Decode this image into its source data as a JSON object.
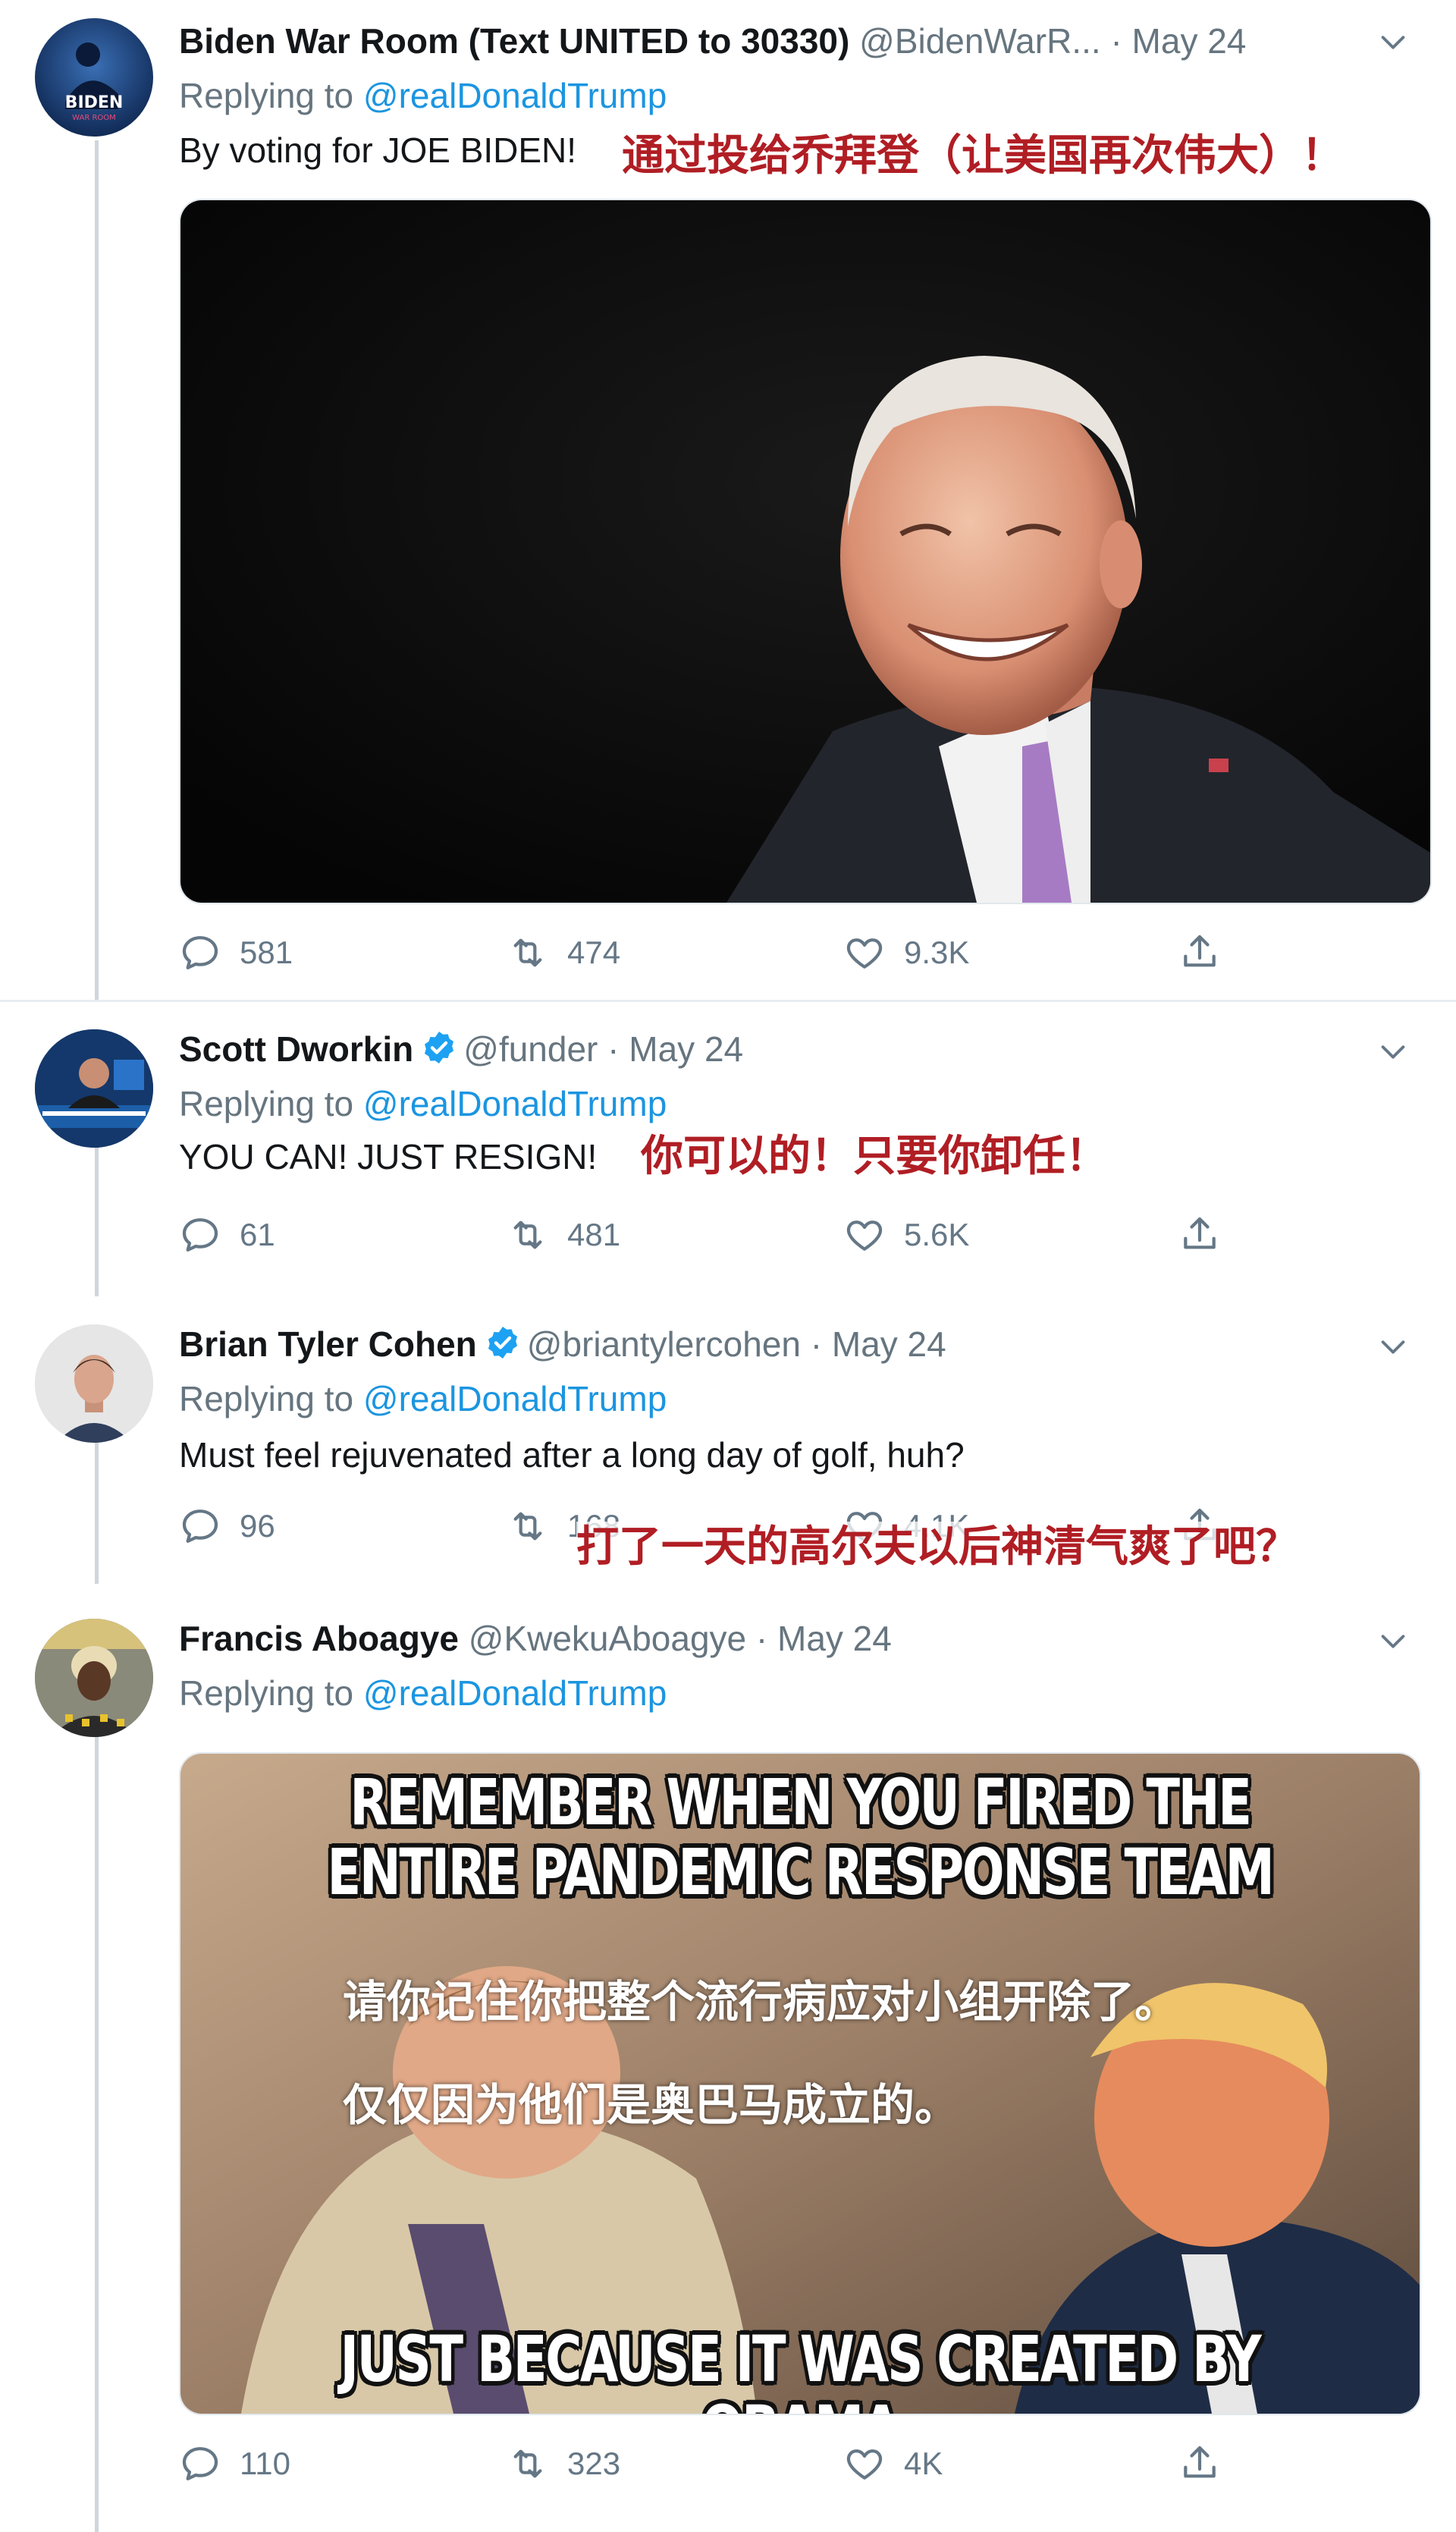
{
  "tweets": [
    {
      "name": "Biden War Room (Text UNITED to 30330)",
      "handle": "@BidenWarR...",
      "date": "· May 24",
      "replying_prefix": "Replying to ",
      "replying_to": "@realDonaldTrump",
      "text": "By voting for JOE BIDEN!",
      "translation": "通过投给乔拜登（让美国再次伟大）！",
      "avatar_text": "BIDEN",
      "avatar_sub": "WAR ROOM",
      "replies": "581",
      "retweets": "474",
      "likes": "9.3K"
    },
    {
      "name": "Scott Dworkin",
      "handle": "@funder",
      "date": "· May 24",
      "replying_prefix": "Replying to ",
      "replying_to": "@realDonaldTrump",
      "text": "YOU CAN! JUST RESIGN!",
      "translation": "你可以的！只要你卸任！",
      "replies": "61",
      "retweets": "481",
      "likes": "5.6K"
    },
    {
      "name": "Brian Tyler Cohen",
      "handle": "@briantylercohen",
      "date": "· May 24",
      "replying_prefix": "Replying to ",
      "replying_to": "@realDonaldTrump",
      "text": "Must feel rejuvenated after a long day of golf, huh?",
      "translation": "打了一天的高尔夫以后神清气爽了吧？",
      "replies": "96",
      "retweets": "168",
      "likes": "4.1K"
    },
    {
      "name": "Francis Aboagye",
      "handle": "@KwekuAboagye",
      "date": "· May 24",
      "replying_prefix": "Replying to ",
      "replying_to": "@realDonaldTrump",
      "meme_top_1": "REMEMBER WHEN YOU FIRED THE",
      "meme_top_2": "ENTIRE PANDEMIC RESPONSE TEAM",
      "meme_bottom": "JUST BECAUSE IT WAS CREATED BY OBAMA",
      "meme_cn_1": "请你记住你把整个流行病应对小组开除了。",
      "meme_cn_2": "仅仅因为他们是奥巴马成立的。",
      "replies": "110",
      "retweets": "323",
      "likes": "4K"
    }
  ],
  "icons": [
    "reply-icon",
    "retweet-icon",
    "like-icon",
    "share-icon",
    "chevron-down-icon",
    "verified-badge-icon"
  ],
  "colors": {
    "link": "#1b95e0",
    "muted": "#66757f",
    "translation": "#b01e24",
    "verified": "#1da1f2"
  }
}
